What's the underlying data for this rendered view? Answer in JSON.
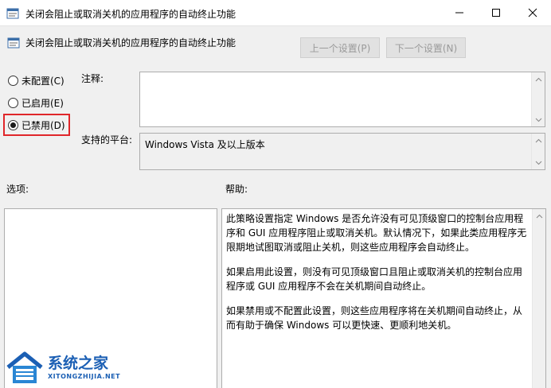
{
  "window": {
    "title": "关闭会阻止或取消关机的应用程序的自动终止功能"
  },
  "header": {
    "title": "关闭会阻止或取消关机的应用程序的自动终止功能",
    "prev_label": "上一个设置(P)",
    "next_label": "下一个设置(N)"
  },
  "options": {
    "not_configured": "未配置(C)",
    "enabled": "已启用(E)",
    "disabled": "已禁用(D)",
    "selected": "disabled"
  },
  "comment": {
    "label": "注释:",
    "value": ""
  },
  "platform": {
    "label": "支持的平台:",
    "value": "Windows Vista 及以上版本"
  },
  "sections": {
    "options_label": "选项:",
    "help_label": "帮助:"
  },
  "help": {
    "paragraphs": [
      "此策略设置指定 Windows 是否允许没有可见顶级窗口的控制台应用程序和 GUI 应用程序阻止或取消关机。默认情况下，如果此类应用程序无限期地试图取消或阻止关机，则这些应用程序会自动终止。",
      "如果启用此设置，则没有可见顶级窗口且阻止或取消关机的控制台应用程序或 GUI 应用程序不会在关机期间自动终止。",
      "如果禁用或不配置此设置，则这些应用程序将在关机期间自动终止，从而有助于确保 Windows 可以更快速、更顺利地关机。"
    ]
  },
  "watermark": {
    "name": "系统之家",
    "url": "XITONGZHIJIA.NET"
  },
  "colors": {
    "highlight": "#e0262a",
    "watermark": "#1b5fb4"
  }
}
